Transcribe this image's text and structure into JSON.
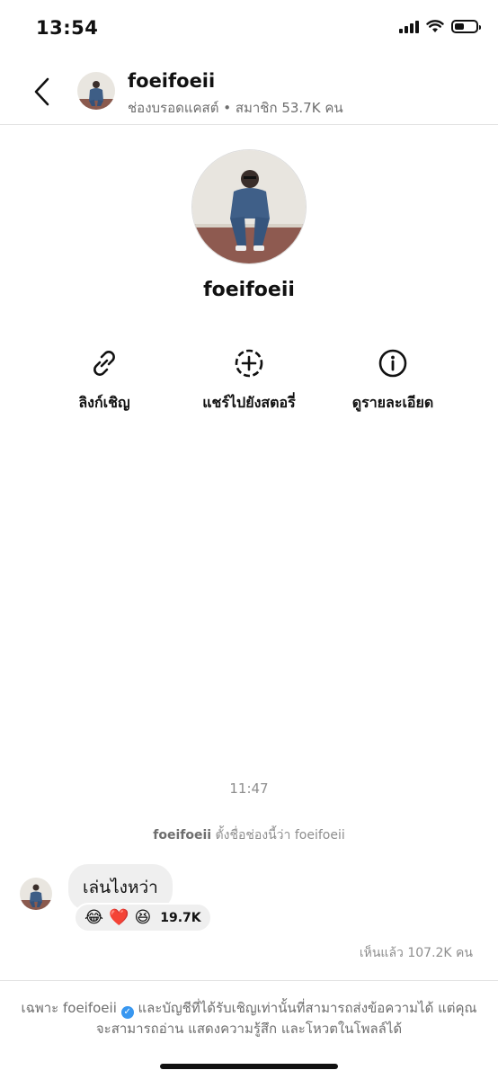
{
  "status_bar": {
    "time": "13:54"
  },
  "header": {
    "name": "foeifoeii",
    "subtitle": "ช่องบรอดแคสต์ • สมาชิก 53.7K คน"
  },
  "profile": {
    "name": "foeifoeii"
  },
  "actions": [
    {
      "label": "ลิงก์เชิญ",
      "icon": "link-icon"
    },
    {
      "label": "แชร์ไปยังสตอรี่",
      "icon": "add-story-icon"
    },
    {
      "label": "ดูรายละเอียด",
      "icon": "info-icon"
    }
  ],
  "chat": {
    "timestamp": "11:47",
    "system_message": {
      "user": "foeifoeii",
      "text": "ตั้งชื่อช่องนี้ว่า foeifoeii"
    },
    "message": "เล่นไงหว่า",
    "reactions": {
      "emojis": [
        "😂",
        "❤️",
        "😆"
      ],
      "count": "19.7K"
    },
    "seen": "เห็นแล้ว 107.2K คน"
  },
  "footer": {
    "prefix": "เฉพาะ foeifoeii",
    "line1_rest": "และบัญชีที่ได้รับเชิญเท่านั้นที่สามารถส่งข้อความได้ แต่คุณ",
    "line2": "จะสามารถอ่าน แสดงความรู้สึก และโหวตในโพลล์ได้"
  }
}
